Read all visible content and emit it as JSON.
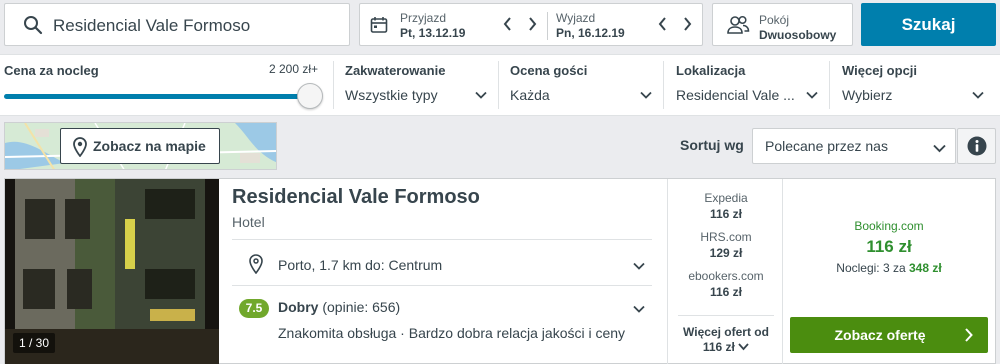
{
  "search": {
    "query": "Residencial Vale Formoso",
    "button": "Szukaj"
  },
  "dates": {
    "checkin_label": "Przyjazd",
    "checkin_value": "Pt, 13.12.19",
    "checkout_label": "Wyjazd",
    "checkout_value": "Pn, 16.12.19"
  },
  "rooms": {
    "label": "Pokój",
    "value": "Dwuosobowy"
  },
  "filters": {
    "price": {
      "title": "Cena za nocleg",
      "max": "2 200 zł+",
      "level": 1.0
    },
    "accommodation": {
      "title": "Zakwaterowanie",
      "value": "Wszystkie typy"
    },
    "rating": {
      "title": "Ocena gości",
      "value": "Każda"
    },
    "location": {
      "title": "Lokalizacja",
      "value": "Residencial Vale ..."
    },
    "more": {
      "title": "Więcej opcji",
      "value": "Wybierz"
    }
  },
  "map": {
    "button": "Zobacz na mapie"
  },
  "sort": {
    "label": "Sortuj wg",
    "value": "Polecane przez nas"
  },
  "hotel": {
    "name": "Residencial Vale Formoso",
    "type": "Hotel",
    "photo_counter": "1 / 30",
    "location": "Porto, 1.7 km do: Centrum",
    "rating_score": "7.5",
    "rating_label": "Dobry",
    "rating_reviews": "(opinie: 656)",
    "rating_summary": "Znakomita obsługa · Bardzo dobra relacja jakości i ceny",
    "offers": [
      {
        "provider": "Expedia",
        "price": "116 zł"
      },
      {
        "provider": "HRS.com",
        "price": "129 zł"
      },
      {
        "provider": "ebookers.com",
        "price": "116 zł"
      }
    ],
    "more_offers_label": "Więcej ofert od",
    "more_offers_price": "116 zł",
    "best": {
      "provider": "Booking.com",
      "price": "116 zł",
      "nights_prefix": "Noclegi: 3 za",
      "nights_total": "348 zł",
      "button": "Zobacz ofertę"
    }
  },
  "colors": {
    "accent": "#007fad",
    "deal": "#4b8d0f",
    "rating": "#71a82c",
    "price": "#2f8f2f"
  }
}
